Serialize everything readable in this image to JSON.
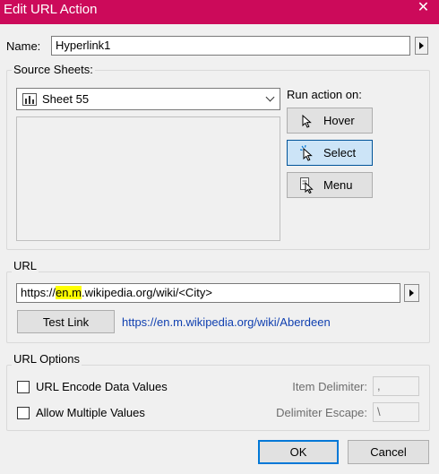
{
  "window": {
    "title": "Edit URL Action",
    "close_glyph": "✕"
  },
  "name": {
    "label": "Name:",
    "value": "Hyperlink1"
  },
  "source_sheets": {
    "group_title": "Source Sheets:",
    "selected_sheet": "Sheet 55",
    "run_action_label": "Run action on:",
    "buttons": {
      "hover": "Hover",
      "select": "Select",
      "menu": "Menu"
    }
  },
  "url": {
    "group_title": "URL",
    "value_parts": {
      "before": "https://",
      "hl1": "en",
      "mid1": ".",
      "hl2": "m",
      "after": ".wikipedia.org/wiki/<City>"
    },
    "test_link_label": "Test Link",
    "preview_link": "https://en.m.wikipedia.org/wiki/Aberdeen"
  },
  "url_options": {
    "group_title": "URL Options",
    "encode_label": "URL Encode Data Values",
    "allow_multiple_label": "Allow Multiple Values",
    "item_delimiter_label": "Item Delimiter:",
    "item_delimiter_value": ",",
    "delimiter_escape_label": "Delimiter Escape:",
    "delimiter_escape_value": "\\"
  },
  "footer": {
    "ok_label": "OK",
    "cancel_label": "Cancel"
  },
  "colors": {
    "titlebar": "#cc0a5a",
    "link": "#0f3fb0",
    "highlight": "#ffff00"
  }
}
